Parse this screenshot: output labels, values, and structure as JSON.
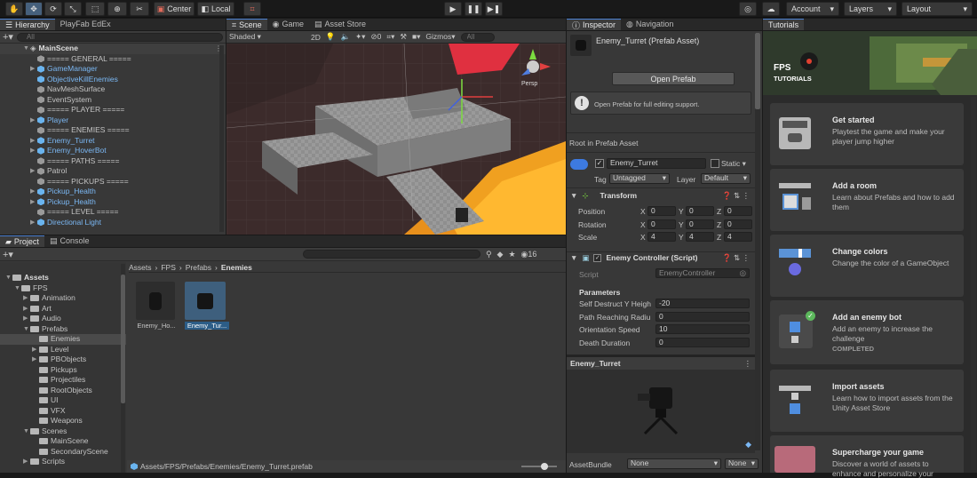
{
  "toolbar": {
    "center_label": "Center",
    "local_label": "Local",
    "account_label": "Account",
    "layers_label": "Layers",
    "layout_label": "Layout"
  },
  "hierarchy": {
    "tab1": "Hierarchy",
    "tab2": "PlayFab EdEx",
    "search_placeholder": "All",
    "scene_name": "MainScene",
    "items": [
      {
        "label": "===== GENERAL =====",
        "blue": false,
        "arrow": false,
        "chev": false
      },
      {
        "label": "GameManager",
        "blue": true,
        "arrow": true,
        "chev": true
      },
      {
        "label": "ObjectiveKillEnemies",
        "blue": true,
        "arrow": false,
        "chev": true
      },
      {
        "label": "NavMeshSurface",
        "blue": false,
        "arrow": false,
        "chev": false
      },
      {
        "label": "EventSystem",
        "blue": false,
        "arrow": false,
        "chev": false
      },
      {
        "label": "===== PLAYER =====",
        "blue": false,
        "arrow": false,
        "chev": false
      },
      {
        "label": "Player",
        "blue": true,
        "arrow": true,
        "chev": true
      },
      {
        "label": "===== ENEMIES =====",
        "blue": false,
        "arrow": false,
        "chev": false
      },
      {
        "label": "Enemy_Turret",
        "blue": true,
        "arrow": true,
        "chev": true
      },
      {
        "label": "Enemy_HoverBot",
        "blue": true,
        "arrow": true,
        "chev": true
      },
      {
        "label": "===== PATHS =====",
        "blue": false,
        "arrow": false,
        "chev": false
      },
      {
        "label": "Patrol",
        "blue": false,
        "arrow": true,
        "chev": false
      },
      {
        "label": "===== PICKUPS =====",
        "blue": false,
        "arrow": false,
        "chev": false
      },
      {
        "label": "Pickup_Health",
        "blue": true,
        "arrow": true,
        "chev": true
      },
      {
        "label": "Pickup_Health",
        "blue": true,
        "arrow": true,
        "chev": true
      },
      {
        "label": "===== LEVEL =====",
        "blue": false,
        "arrow": false,
        "chev": false
      },
      {
        "label": "Directional Light",
        "blue": true,
        "arrow": true,
        "chev": true
      }
    ]
  },
  "scene": {
    "tab_scene": "Scene",
    "tab_game": "Game",
    "tab_store": "Asset Store",
    "shading": "Shaded",
    "mode_2d": "2D",
    "gizmos": "Gizmos",
    "search_placeholder": "All",
    "zero_count": "0",
    "persp": "Persp"
  },
  "project": {
    "tab1": "Project",
    "tab2": "Console",
    "badge": "16",
    "breadcrumb": [
      "Assets",
      "FPS",
      "Prefabs",
      "Enemies"
    ],
    "tree": [
      {
        "label": "Assets",
        "depth": 0,
        "open": true,
        "sel": false,
        "bold": true
      },
      {
        "label": "FPS",
        "depth": 1,
        "open": true,
        "sel": false
      },
      {
        "label": "Animation",
        "depth": 2,
        "open": false,
        "sel": false
      },
      {
        "label": "Art",
        "depth": 2,
        "open": false,
        "sel": false
      },
      {
        "label": "Audio",
        "depth": 2,
        "open": false,
        "sel": false
      },
      {
        "label": "Prefabs",
        "depth": 2,
        "open": true,
        "sel": false
      },
      {
        "label": "Enemies",
        "depth": 3,
        "open": null,
        "sel": true
      },
      {
        "label": "Level",
        "depth": 3,
        "open": false,
        "sel": false
      },
      {
        "label": "PBObjects",
        "depth": 3,
        "open": false,
        "sel": false
      },
      {
        "label": "Pickups",
        "depth": 3,
        "open": null,
        "sel": false
      },
      {
        "label": "Projectiles",
        "depth": 3,
        "open": null,
        "sel": false
      },
      {
        "label": "RootObjects",
        "depth": 3,
        "open": null,
        "sel": false
      },
      {
        "label": "UI",
        "depth": 3,
        "open": null,
        "sel": false
      },
      {
        "label": "VFX",
        "depth": 3,
        "open": null,
        "sel": false
      },
      {
        "label": "Weapons",
        "depth": 3,
        "open": null,
        "sel": false
      },
      {
        "label": "Scenes",
        "depth": 2,
        "open": true,
        "sel": false
      },
      {
        "label": "MainScene",
        "depth": 3,
        "open": null,
        "sel": false
      },
      {
        "label": "SecondaryScene",
        "depth": 3,
        "open": null,
        "sel": false
      },
      {
        "label": "Scripts",
        "depth": 2,
        "open": false,
        "sel": false
      }
    ],
    "assets": [
      {
        "label": "Enemy_Ho..."
      },
      {
        "label": "Enemy_Tur..."
      }
    ],
    "path": "Assets/FPS/Prefabs/Enemies/Enemy_Turret.prefab"
  },
  "inspector": {
    "tab1": "Inspector",
    "tab2": "Navigation",
    "asset_title": "Enemy_Turret (Prefab Asset)",
    "open_prefab": "Open Prefab",
    "hint": "Open Prefab for full editing support.",
    "root_label": "Root in Prefab Asset",
    "object_name": "Enemy_Turret",
    "static_label": "Static",
    "tag_label": "Tag",
    "tag_value": "Untagged",
    "layer_label": "Layer",
    "layer_value": "Default",
    "transform": {
      "title": "Transform",
      "rows": [
        {
          "label": "Position",
          "x": "0",
          "y": "0",
          "z": "0"
        },
        {
          "label": "Rotation",
          "x": "0",
          "y": "0",
          "z": "0"
        },
        {
          "label": "Scale",
          "x": "4",
          "y": "4",
          "z": "4"
        }
      ]
    },
    "script_comp": {
      "title": "Enemy Controller (Script)",
      "script_label": "Script",
      "script_value": "EnemyController",
      "params_label": "Parameters",
      "params": [
        {
          "label": "Self Destruct Y Heigh",
          "value": "-20"
        },
        {
          "label": "Path Reaching Radiu",
          "value": "0"
        },
        {
          "label": "Orientation Speed",
          "value": "10"
        },
        {
          "label": "Death Duration",
          "value": "0"
        }
      ]
    },
    "preview_title": "Enemy_Turret",
    "assetbundle_label": "AssetBundle",
    "bundle_value": "None",
    "variant_value": "None"
  },
  "tutorials": {
    "tab": "Tutorials",
    "banner_title": "FPS",
    "banner_sub": "TUTORIALS",
    "cards": [
      {
        "title": "Get started",
        "desc": "Playtest the game and make your player jump higher",
        "status": ""
      },
      {
        "title": "Add a room",
        "desc": "Learn about Prefabs and how to add them",
        "status": ""
      },
      {
        "title": "Change colors",
        "desc": "Change the color of a GameObject",
        "status": ""
      },
      {
        "title": "Add an enemy bot",
        "desc": "Add an enemy to increase the challenge",
        "status": "COMPLETED"
      },
      {
        "title": "Import assets",
        "desc": "Learn how to import assets from the Unity Asset Store",
        "status": ""
      },
      {
        "title": "Supercharge your game",
        "desc": "Discover a world of assets to enhance and personalize your",
        "status": ""
      }
    ]
  },
  "colors": {
    "accent": "#4a7fd0",
    "selection": "#2c5d87",
    "prefab_blue": "#7bb8f4",
    "completed": "#5cb85c"
  }
}
